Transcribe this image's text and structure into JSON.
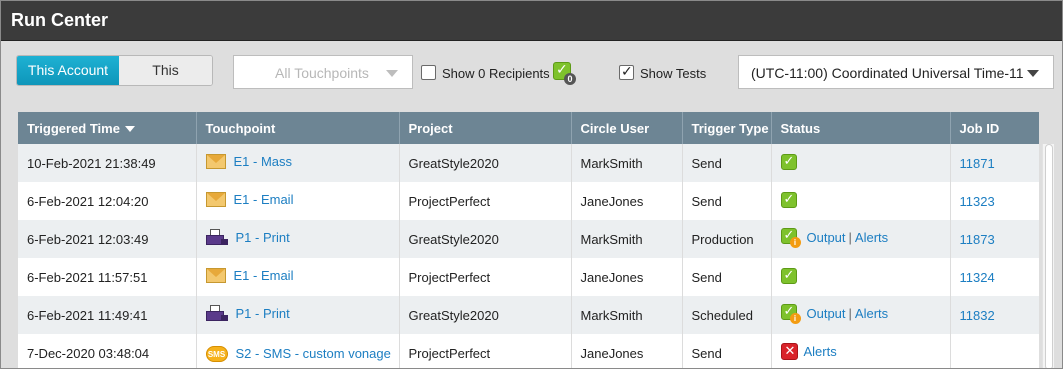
{
  "title": "Run Center",
  "toolbar": {
    "scope": [
      "This Account",
      "This Project"
    ],
    "touchpoints_dropdown": "All Touchpoints",
    "show_zero_recipients": {
      "label": "Show 0 Recipients",
      "checked": false,
      "badge": "0"
    },
    "show_tests": {
      "label": "Show Tests",
      "checked": true,
      "tick": "✓"
    },
    "timezone": "(UTC-11:00) Coordinated Universal Time-11"
  },
  "columns": [
    "Triggered Time",
    "Touchpoint",
    "Project",
    "Circle User",
    "Trigger Type",
    "Status",
    "Job ID"
  ],
  "rows": [
    {
      "time": "10-Feb-2021 21:38:49",
      "icon": "mail",
      "touchpoint": "E1 - Mass",
      "project": "GreatStyle2020",
      "user": "MarkSmith",
      "trigger": "Send",
      "status": "ok",
      "job": "11871"
    },
    {
      "time": "6-Feb-2021 12:04:20",
      "icon": "mail",
      "touchpoint": "E1 - Email",
      "project": "ProjectPerfect",
      "user": "JaneJones",
      "trigger": "Send",
      "status": "ok",
      "job": "11323"
    },
    {
      "time": "6-Feb-2021 12:03:49",
      "icon": "print",
      "touchpoint": "P1 - Print",
      "project": "GreatStyle2020",
      "user": "MarkSmith",
      "trigger": "Production",
      "status": "ok-info",
      "output": "Output",
      "alerts": "Alerts",
      "job": "11873"
    },
    {
      "time": "6-Feb-2021 11:57:51",
      "icon": "mail",
      "touchpoint": "E1 - Email",
      "project": "ProjectPerfect",
      "user": "JaneJones",
      "trigger": "Send",
      "status": "ok",
      "job": "11324"
    },
    {
      "time": "6-Feb-2021 11:49:41",
      "icon": "print",
      "touchpoint": "P1 - Print",
      "project": "GreatStyle2020",
      "user": "MarkSmith",
      "trigger": "Scheduled",
      "status": "ok-info",
      "output": "Output",
      "alerts": "Alerts",
      "job": "11832"
    },
    {
      "time": "7-Dec-2020 03:48:04",
      "icon": "sms",
      "touchpoint": "S2 - SMS - custom vonage",
      "project": "ProjectPerfect",
      "user": "JaneJones",
      "trigger": "Send",
      "status": "error",
      "alerts": "Alerts",
      "job": ""
    }
  ]
}
